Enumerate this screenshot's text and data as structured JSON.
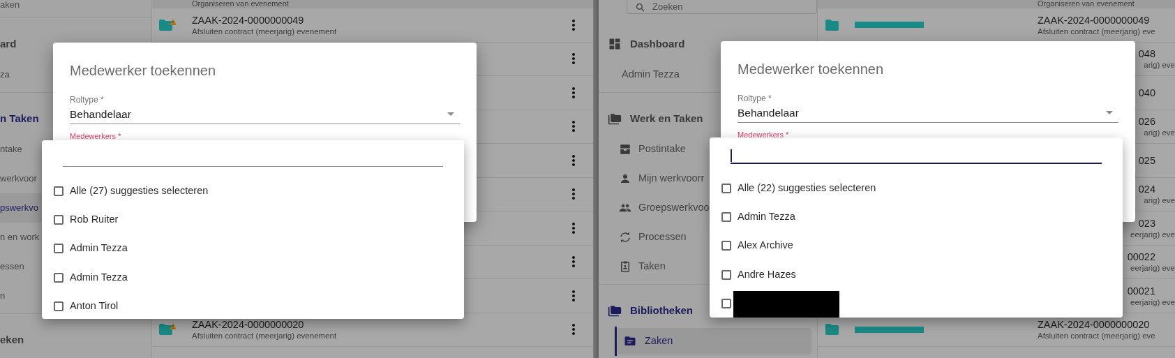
{
  "panels": [
    {
      "sidebar": {
        "top": {
          "kind": "item",
          "label": "aken"
        },
        "groups": [
          {
            "items": [
              {
                "label": "ard",
                "kind": "section",
                "selected": false
              },
              {
                "label": "za",
                "kind": "item",
                "selected": false
              }
            ]
          },
          {
            "items": [
              {
                "label": "n Taken",
                "kind": "section",
                "selected": true
              },
              {
                "label": "ntake",
                "kind": "item",
                "selected": false
              },
              {
                "label": "werkvoor",
                "kind": "item",
                "selected": false
              },
              {
                "label": "pswerkvo",
                "kind": "item",
                "selected": true
              },
              {
                "label": "n en work",
                "kind": "item",
                "selected": false
              },
              {
                "label": "essen",
                "kind": "item",
                "selected": false
              },
              {
                "label": "n",
                "kind": "item",
                "selected": false
              }
            ]
          },
          {
            "items": [
              {
                "label": "eken",
                "kind": "section",
                "selected": false
              }
            ]
          }
        ]
      },
      "list": {
        "header": "Organiseren van evenement",
        "rows": [
          {
            "kind": "full",
            "title": "ZAAK-2024-0000000049",
            "subtitle": "Afsluiten contract (meerjarig) evenement",
            "warning": true,
            "menu": true
          },
          {
            "kind": "covered",
            "menu": true
          },
          {
            "kind": "covered",
            "menu": true
          },
          {
            "kind": "covered",
            "menu": true
          },
          {
            "kind": "covered",
            "menu": true
          },
          {
            "kind": "covered",
            "menu": true
          },
          {
            "kind": "covered",
            "menu": true
          },
          {
            "kind": "covered",
            "menu": true
          },
          {
            "kind": "covered",
            "menu": true
          },
          {
            "kind": "full",
            "title": "ZAAK-2024-0000000020",
            "subtitle": "Afsluiten contract (meerjarig) evenement",
            "warning": true,
            "menu": true
          }
        ]
      },
      "dialog": {
        "title": "Medewerker toekennen",
        "role": {
          "label": "Roltype *",
          "value": "Behandelaar"
        },
        "employees_label": {
          "label": "Medewerkers *",
          "invalid": true
        }
      },
      "dropdown": {
        "search_focused": false,
        "select_all": {
          "label": "Alle (27) suggesties selecteren",
          "checked": false
        },
        "options": [
          {
            "kind": "person",
            "label": "Rob Ruiter",
            "checked": false
          },
          {
            "kind": "person",
            "label": "Admin Tezza",
            "checked": false
          },
          {
            "kind": "person",
            "label": "Admin Tezza",
            "checked": false
          },
          {
            "kind": "person",
            "label": "Anton Tirol",
            "checked": false
          }
        ]
      }
    },
    {
      "sidebar": {
        "top": {
          "kind": "search",
          "placeholder": "Zoeken"
        },
        "groups": [
          {
            "items": [
              {
                "label": "Dashboard",
                "kind": "section",
                "selected": false,
                "icon": true
              },
              {
                "label": "Admin Tezza",
                "kind": "item",
                "selected": false
              }
            ]
          },
          {
            "items": [
              {
                "label": "Werk en Taken",
                "kind": "section",
                "selected": false,
                "icon": true
              },
              {
                "label": "Postintake",
                "kind": "item",
                "selected": false,
                "icon": true
              },
              {
                "label": "Mijn werkvoorr",
                "kind": "item",
                "selected": false,
                "icon": true
              },
              {
                "label": "Groepswerkvoo",
                "kind": "item",
                "selected": false,
                "icon": true
              },
              {
                "label": "Processen",
                "kind": "item",
                "selected": false,
                "icon": true
              },
              {
                "label": "Taken",
                "kind": "item",
                "selected": false,
                "icon": true
              }
            ]
          },
          {
            "items": [
              {
                "label": "Bibliotheken",
                "kind": "section",
                "selected": true,
                "icon": true
              },
              {
                "label": "Zaken",
                "kind": "item",
                "selected": true,
                "icon": true
              }
            ]
          }
        ]
      },
      "list": {
        "header": "Organiseren van evenement",
        "rows": [
          {
            "kind": "full",
            "title": "ZAAK-2024-0000000049",
            "subtitle": "Afsluiten contract (meerjarig) eve",
            "label_bar": true
          },
          {
            "kind": "partial",
            "title": "048",
            "subtitle": "arig) eve"
          },
          {
            "kind": "partial",
            "title": "040"
          },
          {
            "kind": "partial",
            "title": "026",
            "subtitle": "arig) eve"
          },
          {
            "kind": "partial",
            "title": "025"
          },
          {
            "kind": "partial",
            "title": "024",
            "subtitle": "arig) eve"
          },
          {
            "kind": "partial",
            "title": "023",
            "subtitle": "eerjarig) eve"
          },
          {
            "kind": "partial",
            "title": "00022",
            "subtitle": "eerjarig) eve"
          },
          {
            "kind": "partial",
            "title": "00021",
            "subtitle": "eerjarig) eve"
          },
          {
            "kind": "full",
            "title": "ZAAK-2024-0000000020",
            "subtitle": "Afsluiten contract (meerjarig) eve",
            "label_bar": true
          }
        ]
      },
      "dialog": {
        "title": "Medewerker toekennen",
        "role": {
          "label": "Roltype *",
          "value": "Behandelaar"
        },
        "employees_label": {
          "label": "Medewerkers *",
          "invalid": true
        }
      },
      "dropdown": {
        "search_focused": true,
        "select_all": {
          "label": "Alle (22) suggesties selecteren",
          "checked": false
        },
        "options": [
          {
            "kind": "person",
            "label": "Admin Tezza",
            "checked": false
          },
          {
            "kind": "person",
            "label": "Alex Archive",
            "checked": false
          },
          {
            "kind": "person",
            "label": "Andre Hazes",
            "checked": false
          },
          {
            "kind": "redacted",
            "checked": false
          }
        ]
      }
    }
  ]
}
